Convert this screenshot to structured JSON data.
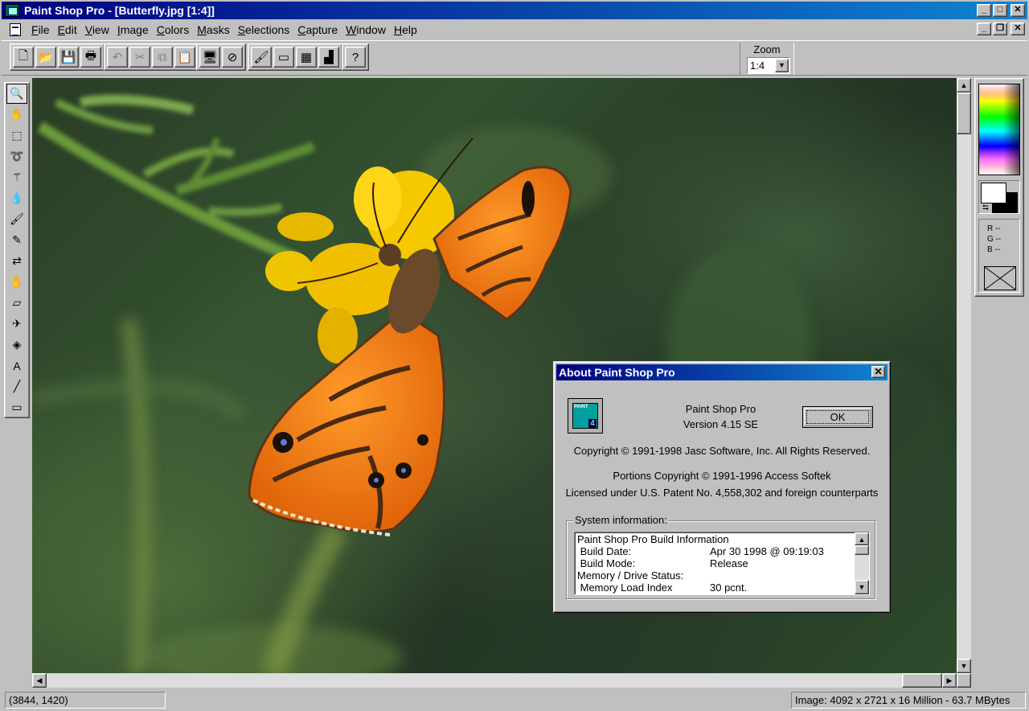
{
  "window": {
    "title": "Paint Shop Pro - [Butterfly.jpg [1:4]]",
    "controls": [
      "_",
      "□",
      "✕"
    ],
    "doc_controls": [
      "_",
      "❐",
      "✕"
    ]
  },
  "menu": [
    "File",
    "Edit",
    "View",
    "Image",
    "Colors",
    "Masks",
    "Selections",
    "Capture",
    "Window",
    "Help"
  ],
  "toolbar": {
    "buttons": [
      {
        "name": "new-icon",
        "glyph": "🗋"
      },
      {
        "name": "open-icon",
        "glyph": "📂"
      },
      {
        "name": "save-icon",
        "glyph": "💾"
      },
      {
        "name": "print-icon",
        "glyph": "🖶"
      },
      {
        "name": "undo-icon",
        "glyph": "↶"
      },
      {
        "name": "cut-icon",
        "glyph": "✂"
      },
      {
        "name": "copy-icon",
        "glyph": "⧉"
      },
      {
        "name": "paste-icon",
        "glyph": "📋"
      },
      {
        "name": "full-screen-icon",
        "glyph": "🖥"
      },
      {
        "name": "normal-viewing-icon",
        "glyph": "⊘"
      },
      {
        "name": "toggle-tool-palette-icon",
        "glyph": "🖌"
      },
      {
        "name": "toggle-style-bar-icon",
        "glyph": "▭"
      },
      {
        "name": "toggle-color-palette-icon",
        "glyph": "▦"
      },
      {
        "name": "histogram-icon",
        "glyph": "▟"
      },
      {
        "name": "context-help-icon",
        "glyph": "?"
      }
    ],
    "zoom_label": "Zoom",
    "zoom_value": "1:4"
  },
  "tools": [
    {
      "name": "zoom-tool-icon",
      "glyph": "🔍"
    },
    {
      "name": "mover-tool-icon",
      "glyph": "✋"
    },
    {
      "name": "selection-tool-icon",
      "glyph": "⬚"
    },
    {
      "name": "freehand-tool-icon",
      "glyph": "➰"
    },
    {
      "name": "magic-wand-tool-icon",
      "glyph": "⚚"
    },
    {
      "name": "dropper-tool-icon",
      "glyph": "💧"
    },
    {
      "name": "paintbrush-tool-icon",
      "glyph": "🖌"
    },
    {
      "name": "clone-brush-tool-icon",
      "glyph": "✎"
    },
    {
      "name": "color-replacer-tool-icon",
      "glyph": "⇄"
    },
    {
      "name": "retouch-tool-icon",
      "glyph": "✋"
    },
    {
      "name": "eraser-tool-icon",
      "glyph": "▱"
    },
    {
      "name": "airbrush-tool-icon",
      "glyph": "✈"
    },
    {
      "name": "flood-fill-tool-icon",
      "glyph": "◈"
    },
    {
      "name": "text-tool-icon",
      "glyph": "A"
    },
    {
      "name": "line-tool-icon",
      "glyph": "╱"
    },
    {
      "name": "shapes-tool-icon",
      "glyph": "▭"
    }
  ],
  "color_panel": {
    "r": "R --",
    "g": "G --",
    "b": "B --",
    "swap_glyph": "⮀"
  },
  "status": {
    "cursor": "(3844, 1420)",
    "image_info": "Image:  4092 x 2721 x 16 Million - 63.7 MBytes"
  },
  "dialog": {
    "title": "About Paint Shop Pro",
    "close": "✕",
    "product": "Paint Shop Pro",
    "version": "Version 4.15 SE",
    "ok_label": "OK",
    "copyright": "Copyright © 1991-1998 Jasc Software, Inc.  All Rights Reserved.",
    "portions": "Portions Copyright © 1991-1996 Access Softek",
    "patent": "Licensed under U.S. Patent No. 4,558,302 and foreign counterparts",
    "sysinfo_label": "System information:",
    "sysinfo_rows": [
      {
        "label": "Paint Shop Pro Build Information",
        "value": ""
      },
      {
        "label": " Build Date:",
        "value": "Apr 30 1998 @ 09:19:03"
      },
      {
        "label": " Build Mode:",
        "value": "Release"
      },
      {
        "label": "Memory / Drive Status:",
        "value": ""
      },
      {
        "label": " Memory Load Index",
        "value": "30 pcnt."
      }
    ]
  }
}
